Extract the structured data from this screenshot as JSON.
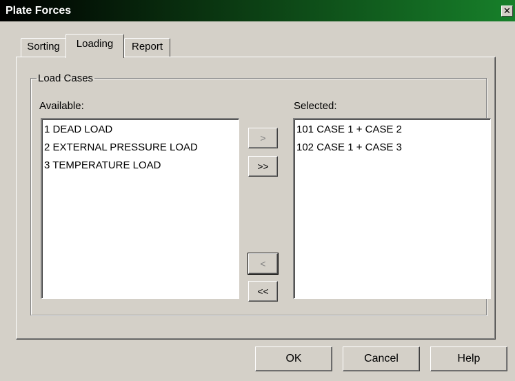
{
  "window": {
    "title": "Plate Forces",
    "close_glyph": "✕"
  },
  "tabs": [
    {
      "label": "Sorting",
      "active": false
    },
    {
      "label": "Loading",
      "active": true
    },
    {
      "label": "Report",
      "active": false
    }
  ],
  "load_cases": {
    "group_label": "Load Cases",
    "available_label": "Available:",
    "selected_label": "Selected:",
    "available": [
      "1 DEAD LOAD",
      "2 EXTERNAL PRESSURE LOAD",
      "3 TEMPERATURE LOAD"
    ],
    "selected": [
      "101 CASE 1 + CASE 2",
      "102 CASE 1 + CASE 3"
    ],
    "buttons": {
      "add": ">",
      "add_all": ">>",
      "remove": "<",
      "remove_all": "<<"
    }
  },
  "footer": {
    "ok": "OK",
    "cancel": "Cancel",
    "help": "Help"
  }
}
